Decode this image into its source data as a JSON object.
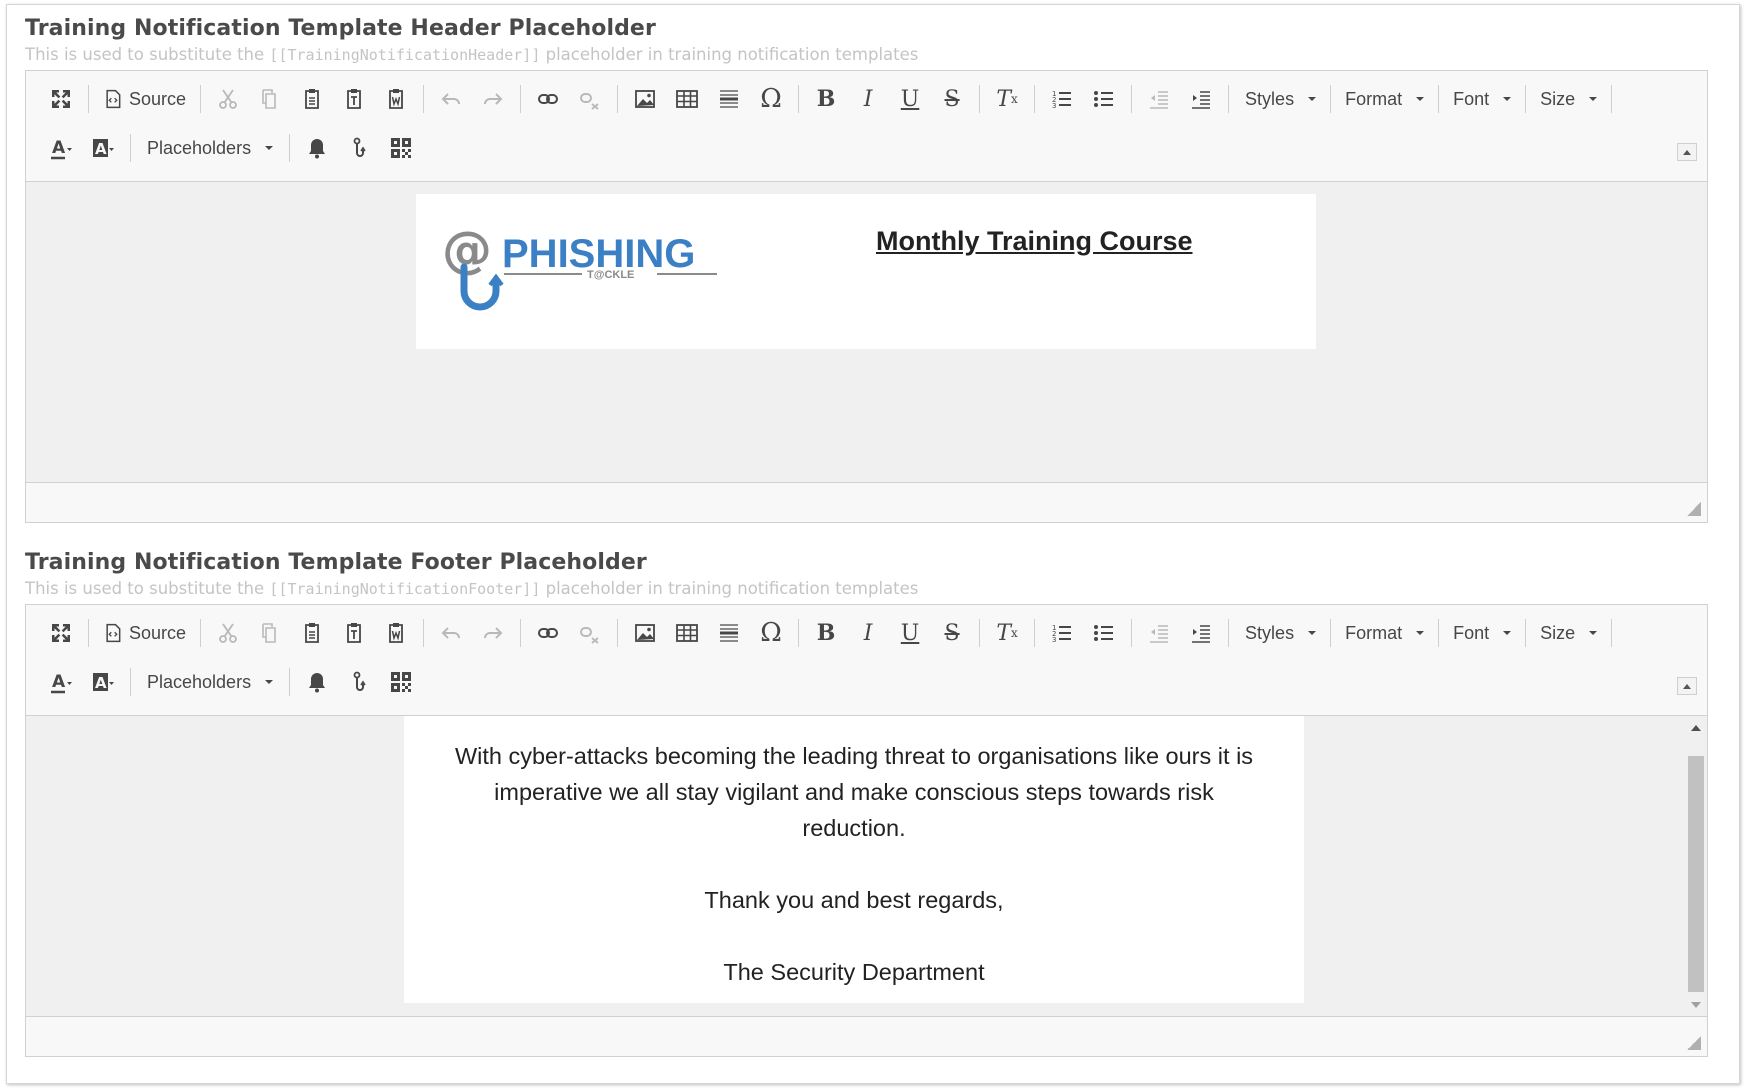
{
  "header_section": {
    "title": "Training Notification Template Header Placeholder",
    "desc_prefix": "This is used to substitute the ",
    "desc_code": "[[TrainingNotificationHeader]]",
    "desc_suffix": " placeholder in training notification templates",
    "content": {
      "logo_text": "PHISHING",
      "logo_subtext": "TACKLE",
      "heading": "Monthly Training Course"
    }
  },
  "footer_section": {
    "title": "Training Notification Template Footer Placeholder",
    "desc_prefix": "This is used to substitute the ",
    "desc_code": "[[TrainingNotificationFooter]]",
    "desc_suffix": " placeholder in training notification templates",
    "content": {
      "paragraph1": "With cyber-attacks becoming the leading threat to organisations like ours it is imperative we all stay vigilant and make conscious steps towards risk reduction.",
      "paragraph2": "Thank you and best regards,",
      "paragraph3": "The Security Department"
    }
  },
  "toolbar": {
    "source_label": "Source",
    "styles_label": "Styles",
    "format_label": "Format",
    "font_label": "Font",
    "size_label": "Size",
    "placeholders_label": "Placeholders",
    "icons": [
      "maximize-icon",
      "source-icon",
      "cut-icon",
      "copy-icon",
      "paste-icon",
      "paste-text-icon",
      "paste-word-icon",
      "undo-icon",
      "redo-icon",
      "link-icon",
      "unlink-icon",
      "image-icon",
      "table-icon",
      "horizontal-line-icon",
      "special-char-icon",
      "bold-icon",
      "italic-icon",
      "underline-icon",
      "strikethrough-icon",
      "remove-format-icon",
      "numbered-list-icon",
      "bulleted-list-icon",
      "outdent-icon",
      "indent-icon",
      "text-color-icon",
      "background-color-icon",
      "bell-icon",
      "hook-icon",
      "qr-code-icon"
    ]
  },
  "colors": {
    "logo_blue": "#3b7fc4",
    "logo_gray": "#8a8a8a",
    "toolbar_bg": "#f8f8f8",
    "content_bg": "#f0f0f0"
  }
}
